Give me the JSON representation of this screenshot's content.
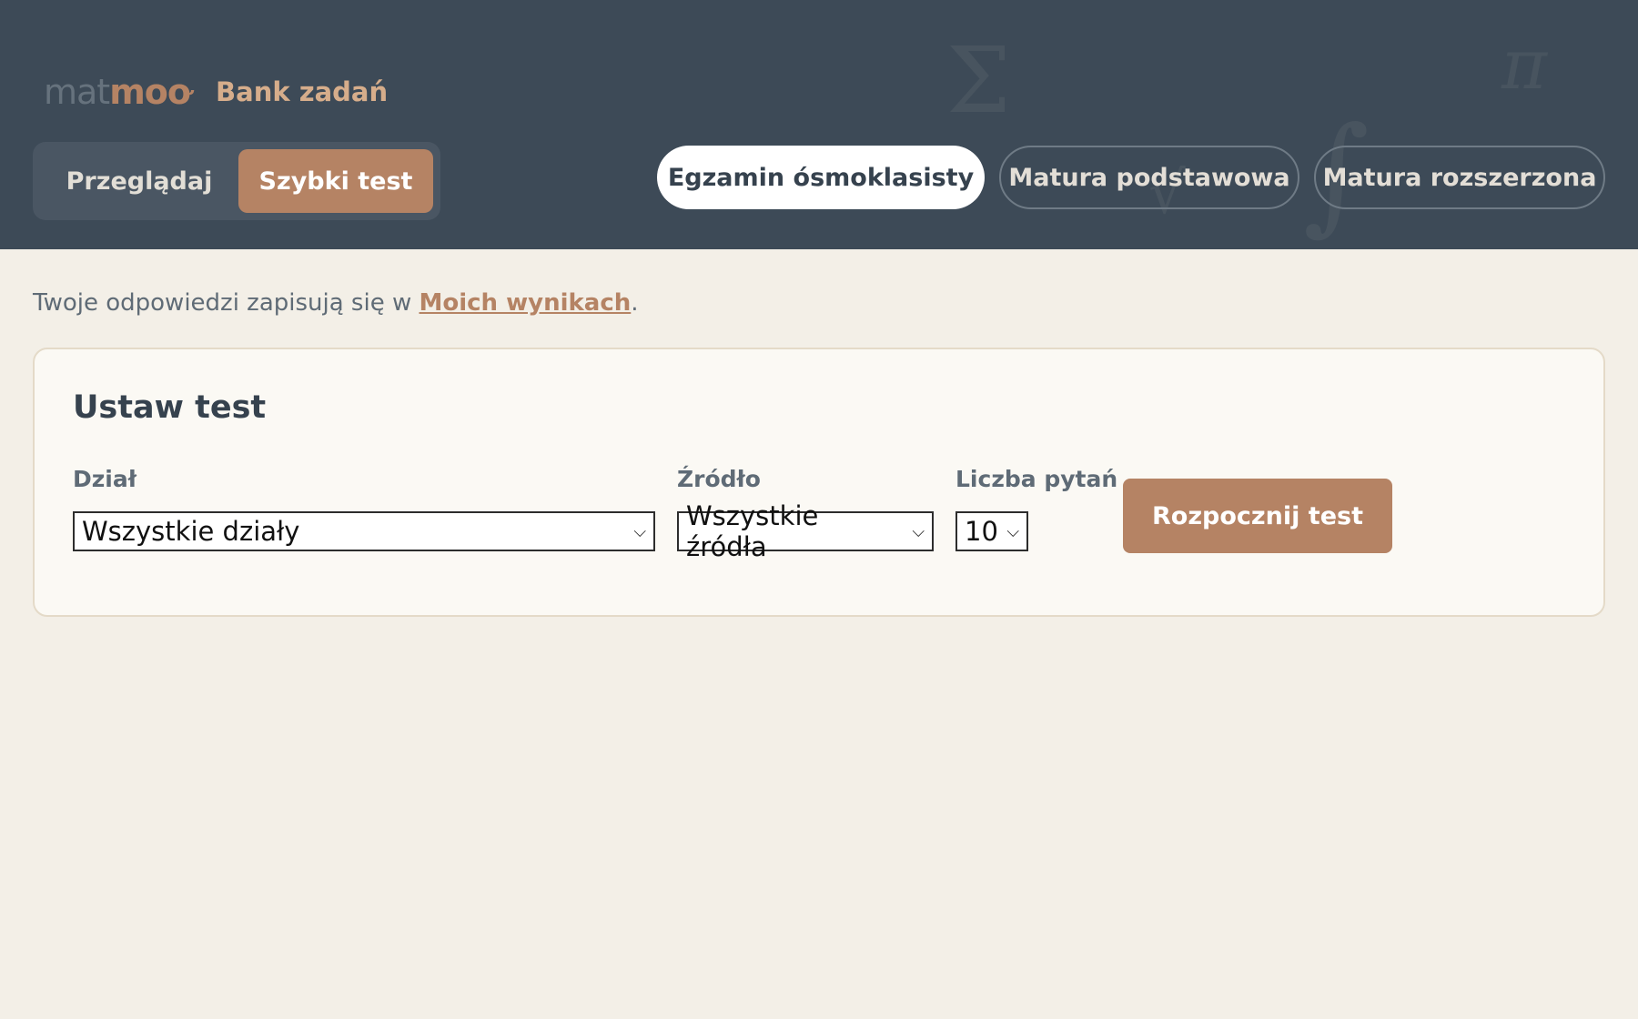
{
  "header": {
    "logo_mat": "mat",
    "logo_moo": "moo",
    "title": "Bank zadań",
    "modes": {
      "browse": "Przeglądaj",
      "quick_test": "Szybki test"
    },
    "exams": [
      "Egzamin ósmoklasisty",
      "Matura podstawowa",
      "Matura rozszerzona"
    ]
  },
  "info": {
    "prefix": "Twoje odpowiedzi zapisują się w ",
    "link": "Moich wynikach",
    "suffix": "."
  },
  "card": {
    "title": "Ustaw test",
    "section_label": "Dział",
    "section_value": "Wszystkie działy",
    "source_label": "Źródło",
    "source_value": "Wszystkie źródła",
    "count_label": "Liczba pytań",
    "count_value": "10",
    "start_button": "Rozpocznij test"
  },
  "colors": {
    "header_bg": "#3d4a57",
    "accent": "#b58364",
    "page_bg": "#f3efe7",
    "card_bg": "#fbf9f4"
  },
  "icons": [
    "sigma-decoration",
    "pi-decoration",
    "integral-decoration",
    "sqrt-decoration",
    "chevron-down-icon"
  ]
}
